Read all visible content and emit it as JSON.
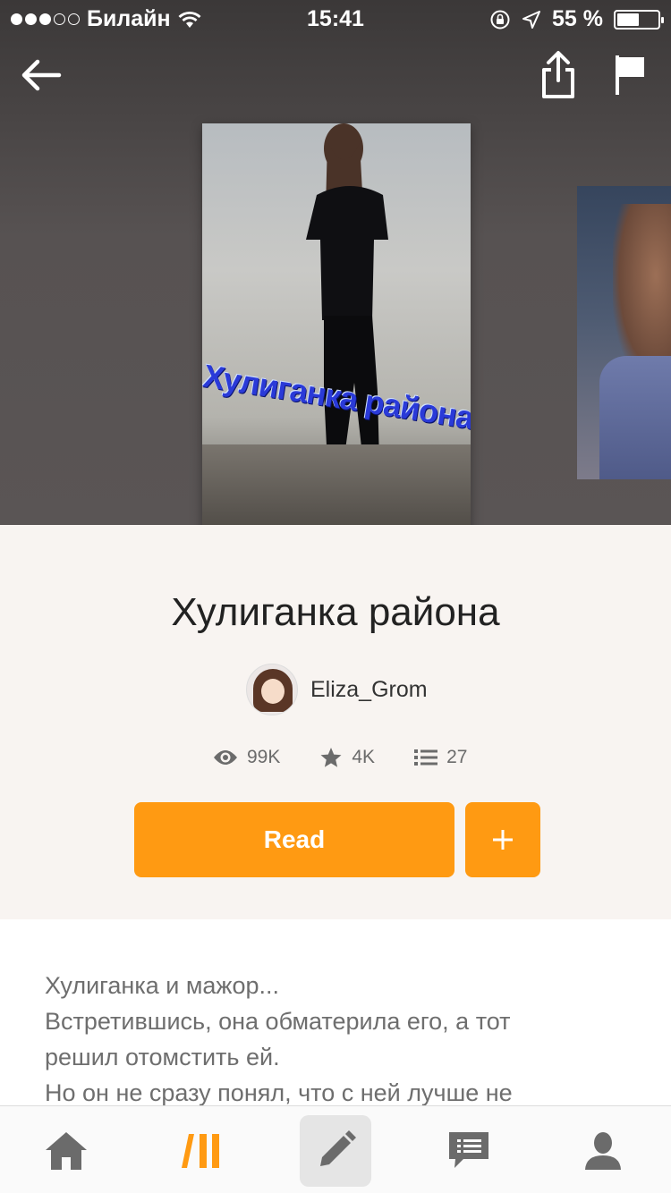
{
  "status_bar": {
    "carrier": "Билайн",
    "time": "15:41",
    "battery_percent": "55 %",
    "battery_level": 0.55,
    "signal_bars_filled": 3,
    "signal_bars_total": 5
  },
  "nav": {
    "back_icon": "arrow-left-icon",
    "share_icon": "share-icon",
    "report_icon": "flag-icon"
  },
  "cover": {
    "title_text": "Хулиганка района"
  },
  "story": {
    "title": "Хулиганка района",
    "author": "Eliza_Grom",
    "reads": "99K",
    "votes": "4K",
    "parts": "27"
  },
  "actions": {
    "read_label": "Read",
    "add_label": "+"
  },
  "description": {
    "lines": [
      "Хулиганка и мажор...",
      "Встретившись, она обматерила его, а тот",
      "решил отомстить ей.",
      "Но он не сразу понял, что с ней лучше не"
    ]
  },
  "tabbar": {
    "items": [
      "home-icon",
      "discover-icon",
      "write-icon",
      "inbox-icon",
      "profile-icon"
    ],
    "active": "discover-icon"
  },
  "colors": {
    "accent": "#ff9a12",
    "hero_bg": "#575252",
    "page_bg": "#f8f4f1"
  }
}
